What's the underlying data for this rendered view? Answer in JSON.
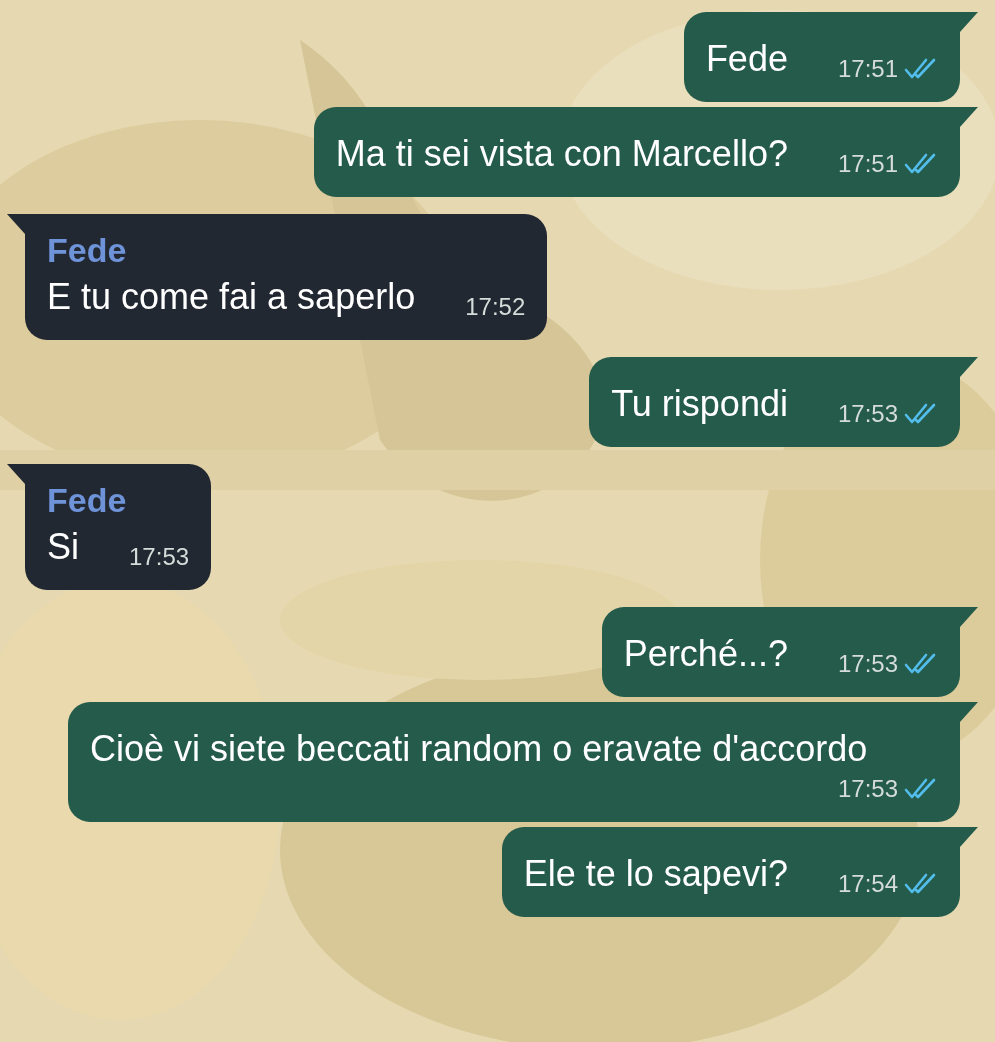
{
  "messages": [
    {
      "kind": "out",
      "text": "Fede",
      "time": "17:51",
      "read": true
    },
    {
      "kind": "out",
      "text": "Ma ti sei vista con Marcello?",
      "time": "17:51",
      "read": true
    },
    {
      "kind": "in",
      "sender": "Fede",
      "text": "E tu come fai a saperlo",
      "time": "17:52"
    },
    {
      "kind": "out",
      "text": "Tu rispondi",
      "time": "17:53",
      "read": true
    },
    {
      "kind": "in",
      "sender": "Fede",
      "text": "Si",
      "time": "17:53"
    },
    {
      "kind": "out",
      "text": "Perché...?",
      "time": "17:53",
      "read": true
    },
    {
      "kind": "out",
      "text": "Cioè vi siete beccati random o eravate d'accordo",
      "time": "17:53",
      "read": true
    },
    {
      "kind": "out",
      "text": "Ele te lo sapevi?",
      "time": "17:54",
      "read": true
    }
  ]
}
